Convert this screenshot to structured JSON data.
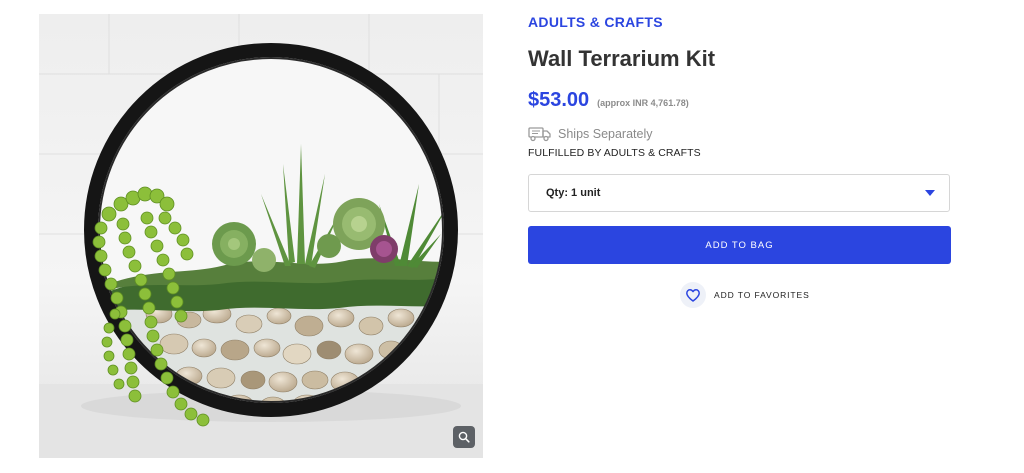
{
  "product": {
    "brand": "ADULTS & CRAFTS",
    "title": "Wall Terrarium Kit",
    "price": "$53.00",
    "price_approx": "(approx INR 4,761.78)",
    "shipping": {
      "icon": "truck-icon",
      "text": "Ships Separately"
    },
    "fulfilled_by": "FULFILLED BY ADULTS & CRAFTS"
  },
  "quantity": {
    "selected": "Qty: 1 unit"
  },
  "actions": {
    "add_to_bag": "ADD TO BAG",
    "add_to_favorites": "ADD TO FAVORITES"
  },
  "gallery": {
    "zoom_icon": "magnifier-icon"
  },
  "colors": {
    "accent": "#2b45e0",
    "muted_text": "#8a8a8a"
  }
}
